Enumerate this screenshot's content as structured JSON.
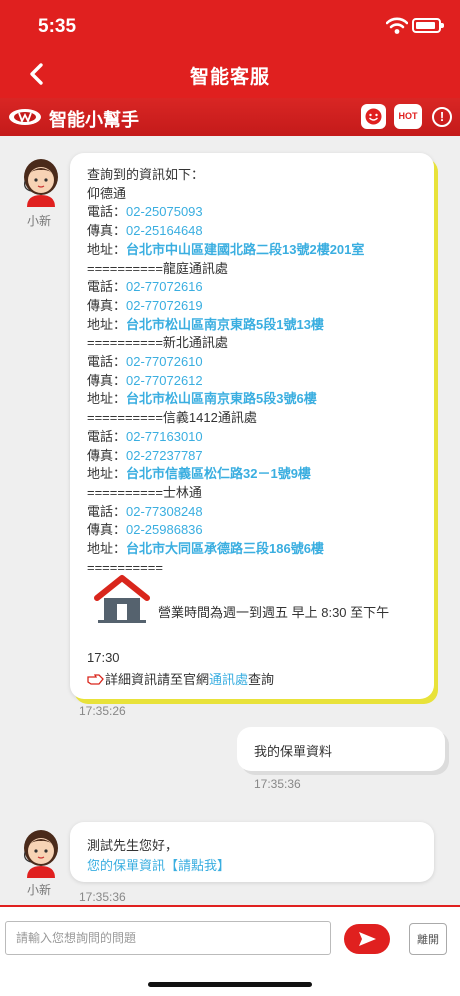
{
  "status_bar": {
    "time": "5:35"
  },
  "nav": {
    "title": "智能客服"
  },
  "assistant_header": {
    "name": "智能小幫手",
    "hot_label": "HOT",
    "info_label": "!"
  },
  "avatar_label": "小新",
  "messages": {
    "main": {
      "lines": [
        {
          "text": "查詢到的資訊如下："
        },
        {
          "text": "仰德通"
        },
        {
          "label": "電話：",
          "value": "02-25075093"
        },
        {
          "label": "傳真：",
          "value": "02-25164648"
        },
        {
          "label": "地址：",
          "value": "台北市中山區建國北路二段13號2樓201室",
          "bold": true
        },
        {
          "text": "==========龍庭通訊處"
        },
        {
          "label": "電話：",
          "value": "02-77072616"
        },
        {
          "label": "傳真：",
          "value": "02-77072619"
        },
        {
          "label": "地址：",
          "value": "台北市松山區南京東路5段1號13樓",
          "bold": true
        },
        {
          "text": "==========新北通訊處"
        },
        {
          "label": "電話：",
          "value": "02-77072610"
        },
        {
          "label": "傳真：",
          "value": "02-77072612"
        },
        {
          "label": "地址：",
          "value": "台北市松山區南京東路5段3號6樓",
          "bold": true
        },
        {
          "text": "==========信義1412通訊處"
        },
        {
          "label": "電話：",
          "value": "02-77163010"
        },
        {
          "label": "傳真：",
          "value": "02-27237787"
        },
        {
          "label": "地址：",
          "value": "台北市信義區松仁路32－1號9樓",
          "bold": true
        },
        {
          "text": "==========士林通"
        },
        {
          "label": "電話：",
          "value": "02-77308248"
        },
        {
          "label": "傳真：",
          "value": "02-25986836"
        },
        {
          "label": "地址：",
          "value": "台北市大同區承德路三段186號6樓",
          "bold": true
        },
        {
          "text": "=========="
        }
      ],
      "hours": "營業時間為週一到週五 早上 8:30 至下午",
      "closing": "17:30",
      "detail_prefix": "詳細資訊請至官網",
      "detail_link": "通訊處",
      "detail_suffix": "查詢",
      "time": "17:35:26"
    },
    "user": {
      "text": "我的保單資料",
      "time": "17:35:36"
    },
    "reply": {
      "line1": "測試先生您好，",
      "line2": "您的保單資訊【請點我】",
      "time": "17:35:36"
    }
  },
  "input": {
    "placeholder": "請輸入您想詢問的問題",
    "leave_label": "離開"
  }
}
